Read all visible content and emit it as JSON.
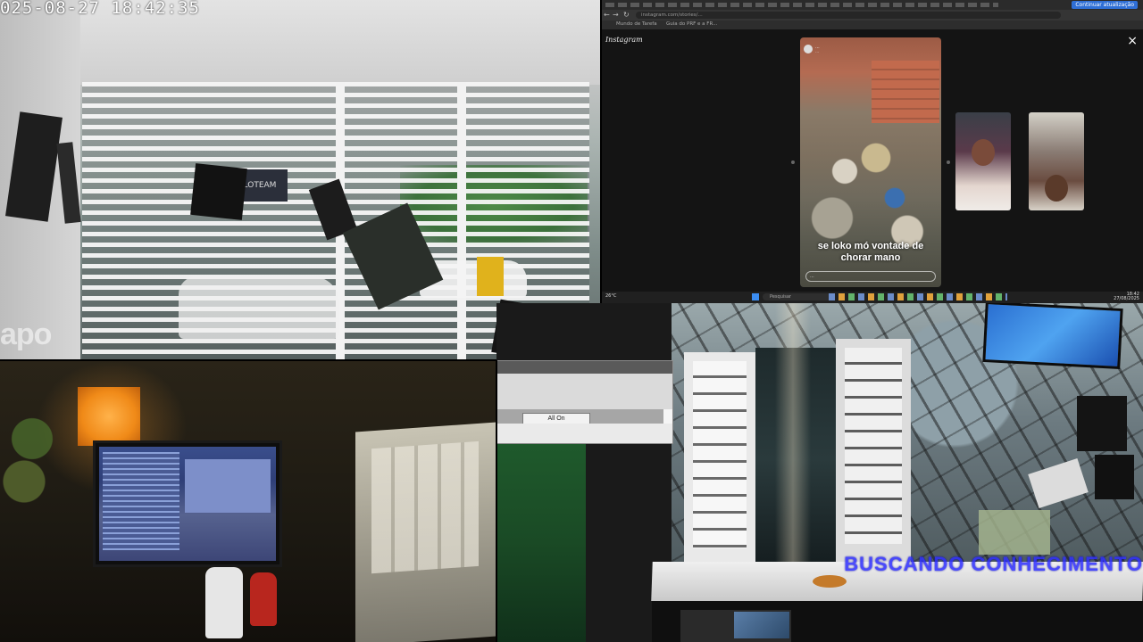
{
  "camera_top_left": {
    "timestamp": "025-08-27  18:42:35",
    "brand_watermark": "apo",
    "sign_text": "LOTEAM"
  },
  "browser": {
    "url": "instagram.com/stories/...",
    "bookmarks": [
      "Mundo de Tarefa",
      "Guia do PRF e a FR..."
    ],
    "profile_button": "Continuar atualização",
    "instagram_logo": "Instagram",
    "close_label": "×",
    "story": {
      "username": "...",
      "subtitle": "...",
      "caption": "se loko mó vontade de chorar mano",
      "reply_placeholder": "..."
    },
    "taskbar": {
      "weather": "26°C",
      "search_placeholder": "Pesquisar",
      "time": "18:42",
      "date": "27/08/2025"
    }
  },
  "dialog": {
    "all_on_label": "All On"
  },
  "camera_bottom_right": {
    "overlay_text": "BUSCANDO CONHECIMENTO"
  }
}
